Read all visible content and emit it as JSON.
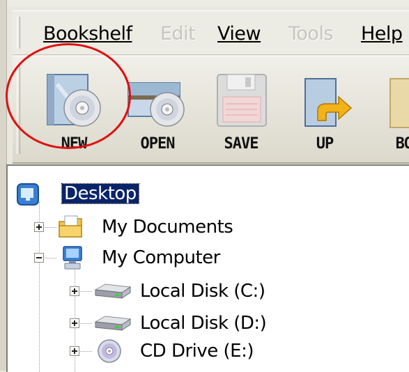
{
  "menubar": {
    "items": [
      {
        "label": "Bookshelf",
        "enabled": true
      },
      {
        "label": "Edit",
        "enabled": false
      },
      {
        "label": "View",
        "enabled": true
      },
      {
        "label": "Tools",
        "enabled": false
      },
      {
        "label": "Help",
        "enabled": true
      }
    ]
  },
  "toolbar": {
    "buttons": [
      {
        "label": "NEW",
        "icon": "new-book-disc-icon",
        "highlighted": true
      },
      {
        "label": "OPEN",
        "icon": "open-book-disc-icon"
      },
      {
        "label": "SAVE",
        "icon": "floppy-disk-icon"
      },
      {
        "label": "UP",
        "icon": "folder-up-arrow-icon"
      },
      {
        "label": "BOO",
        "icon": "book-icon"
      }
    ]
  },
  "tree": {
    "root": {
      "label": "Desktop",
      "icon": "desktop-icon",
      "selected": true
    },
    "items": [
      {
        "label": "My Documents",
        "icon": "my-documents-icon",
        "expander": "plus"
      },
      {
        "label": "My Computer",
        "icon": "my-computer-icon",
        "expander": "minus"
      },
      {
        "label": "Local Disk (C:)",
        "icon": "hard-disk-icon",
        "expander": "plus"
      },
      {
        "label": "Local Disk (D:)",
        "icon": "hard-disk-icon",
        "expander": "plus"
      },
      {
        "label": "CD Drive (E:)",
        "icon": "cd-drive-icon",
        "expander": "plus"
      }
    ]
  },
  "colors": {
    "highlight_circle": "#e01010",
    "selection": "#0a246a"
  }
}
